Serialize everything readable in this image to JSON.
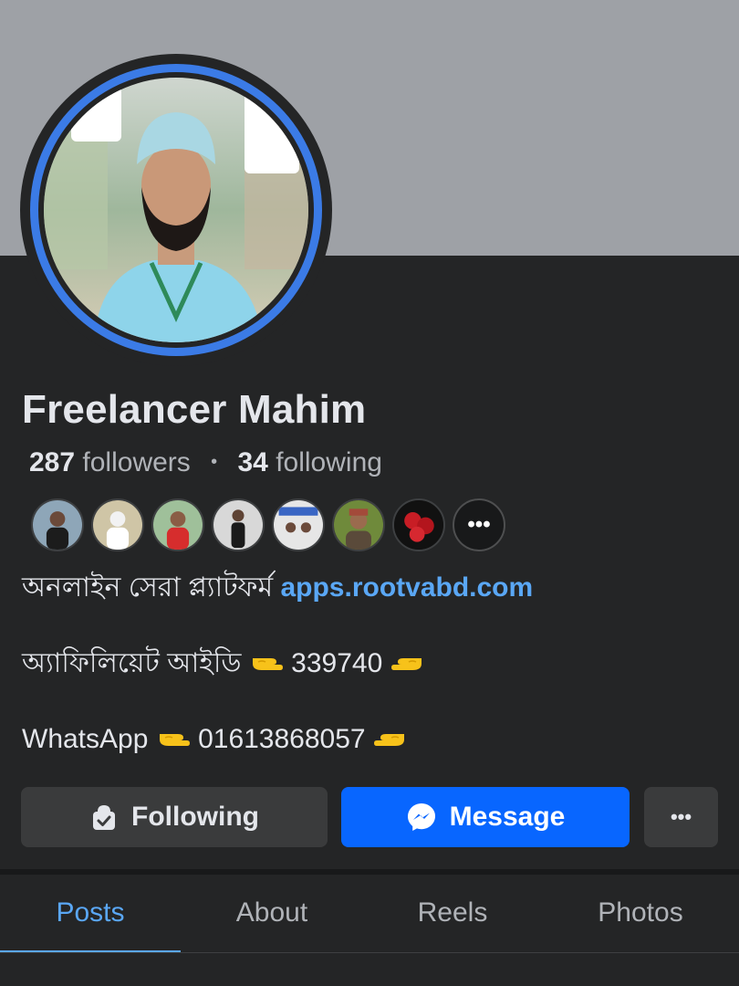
{
  "profile": {
    "name": "Freelancer Mahim",
    "followers_count": "287",
    "followers_label": "followers",
    "following_count": "34",
    "following_label": "following",
    "avatar_icon": "profile-photo",
    "friends_more_label": "•••"
  },
  "bio": {
    "line1_text": "অনলাইন সেরা প্ল্যাটফর্ম ",
    "line1_link": "apps.rootvabd.com",
    "line2_text": "অ্যাফিলিয়েট আইডি ",
    "line2_value": " 339740 ",
    "line3_text": "WhatsApp ",
    "line3_value": " 01613868057 "
  },
  "actions": {
    "following_label": "Following",
    "message_label": "Message",
    "more_label": "•••"
  },
  "tabs": [
    {
      "label": "Posts",
      "active": true
    },
    {
      "label": "About",
      "active": false
    },
    {
      "label": "Reels",
      "active": false
    },
    {
      "label": "Photos",
      "active": false
    }
  ],
  "colors": {
    "background": "#242526",
    "cover": "#9ea1a6",
    "accent": "#5aa7f5",
    "message_button": "#0866ff"
  }
}
